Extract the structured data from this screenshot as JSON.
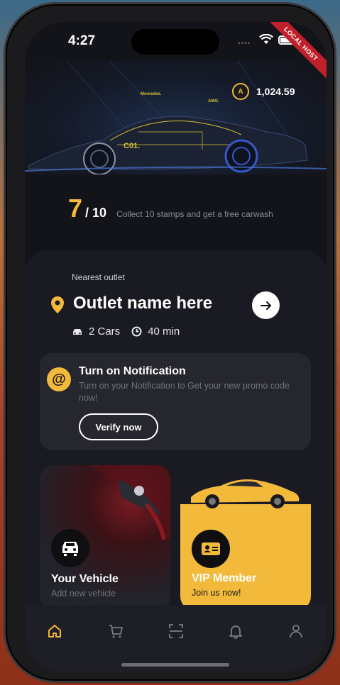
{
  "status_bar": {
    "time": "4:27",
    "ribbon": "LOCAL HOST"
  },
  "hero": {
    "car_brand": "Mercedes.",
    "car_badge": "AMG.",
    "car_code": "C01.",
    "points": {
      "coin_label": "A",
      "value": "1,024.59"
    }
  },
  "stamps": {
    "count": "7",
    "total": "/ 10",
    "description": "Collect 10 stamps and get a free carwash"
  },
  "outlet": {
    "label": "Nearest outlet",
    "name": "Outlet name here",
    "cars": "2 Cars",
    "wait": "40 min"
  },
  "notification": {
    "icon_label": "@",
    "title": "Turn on Notification",
    "description": "Turn on your Notification to Get your new promo code now!",
    "button": "Verify now"
  },
  "cards": {
    "vehicle": {
      "title": "Your Vehicle",
      "subtitle": "Add new vehicle"
    },
    "vip": {
      "title": "VIP Member",
      "subtitle": "Join us now!"
    }
  },
  "nav": [
    "home-icon",
    "cart-icon",
    "scan-icon",
    "bell-icon",
    "profile-icon"
  ],
  "colors": {
    "accent": "#f2b93b",
    "background": "#131419",
    "card": "#25262e"
  }
}
